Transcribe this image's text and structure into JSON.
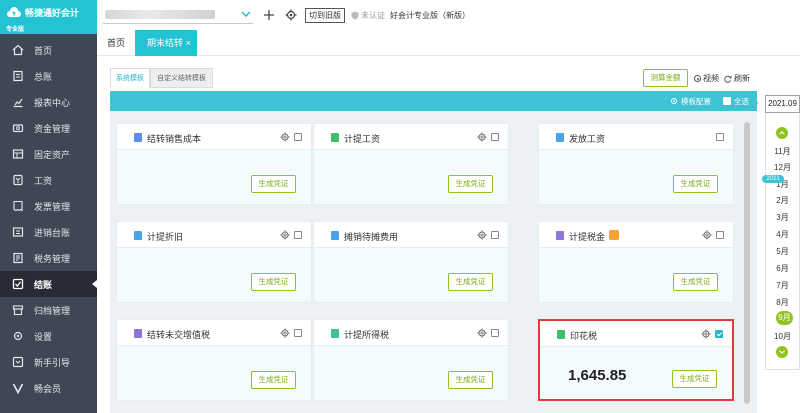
{
  "app": {
    "name": "畅捷通好会计",
    "edition": "专业版"
  },
  "sidebar": {
    "items": [
      {
        "label": "首页",
        "icon": "home-icon"
      },
      {
        "label": "总账",
        "icon": "ledger-icon"
      },
      {
        "label": "报表中心",
        "icon": "chart-icon"
      },
      {
        "label": "资金管理",
        "icon": "money-icon"
      },
      {
        "label": "固定资产",
        "icon": "asset-icon"
      },
      {
        "label": "工资",
        "icon": "salary-icon"
      },
      {
        "label": "发票管理",
        "icon": "invoice-icon"
      },
      {
        "label": "进销台账",
        "icon": "inventory-icon"
      },
      {
        "label": "税务管理",
        "icon": "tax-icon"
      },
      {
        "label": "结账",
        "icon": "closing-icon",
        "active": true
      },
      {
        "label": "归档管理",
        "icon": "archive-icon"
      },
      {
        "label": "设置",
        "icon": "settings-icon"
      },
      {
        "label": "新手引导",
        "icon": "guide-icon"
      },
      {
        "label": "畅会员",
        "icon": "vip-icon"
      }
    ]
  },
  "topbar": {
    "switch_old": "切到旧版",
    "cert_status": "未认证",
    "product": "好会计专业版（新版）"
  },
  "tabs": {
    "home": "首页",
    "current": "期末结转",
    "close": "×"
  },
  "subtabs": {
    "system": "系统模板",
    "custom": "自定义结转模板"
  },
  "toolbar": {
    "measure": "测算金额",
    "view": "视频",
    "refresh": "刷新",
    "template_config": "模板配置",
    "select_all": "全选"
  },
  "cards": [
    {
      "title": "结转销售成本",
      "icon_color": "#5b8def",
      "gen": "生成凭证",
      "gear": true,
      "checked": false
    },
    {
      "title": "计提工资",
      "icon_color": "#3fbf6b",
      "gen": "生成凭证",
      "gear": true,
      "checked": false
    },
    {
      "title": "发放工资",
      "icon_color": "#4aa3e8",
      "gen": "生成凭证",
      "gear": false,
      "checked": false
    },
    {
      "title": "计提折旧",
      "icon_color": "#4aa3e8",
      "gen": "生成凭证",
      "gear": true,
      "checked": false
    },
    {
      "title": "摊销待摊费用",
      "icon_color": "#4aa3e8",
      "gen": "生成凭证",
      "gear": true,
      "checked": false
    },
    {
      "title": "计提税金",
      "icon_color": "#8e74d8",
      "gen": "生成凭证",
      "gear": true,
      "checked": false,
      "badge": true
    },
    {
      "title": "结转未交增值税",
      "icon_color": "#8e74d8",
      "gen": "生成凭证",
      "gear": true,
      "checked": false
    },
    {
      "title": "计提所得税",
      "icon_color": "#3fbf9a",
      "gen": "生成凭证",
      "gear": true,
      "checked": false
    },
    {
      "title": "印花税",
      "icon_color": "#3fbf6b",
      "gen": "生成凭证",
      "gear": true,
      "checked": true,
      "amount": "1,645.85",
      "highlight": true
    }
  ],
  "picker": {
    "current": "2021.09",
    "year_tag": "2021",
    "months": [
      "11月",
      "12月",
      "1月",
      "2月",
      "3月",
      "4月",
      "5月",
      "6月",
      "7月",
      "8月",
      "9月",
      "10月"
    ],
    "selected": "9月"
  }
}
